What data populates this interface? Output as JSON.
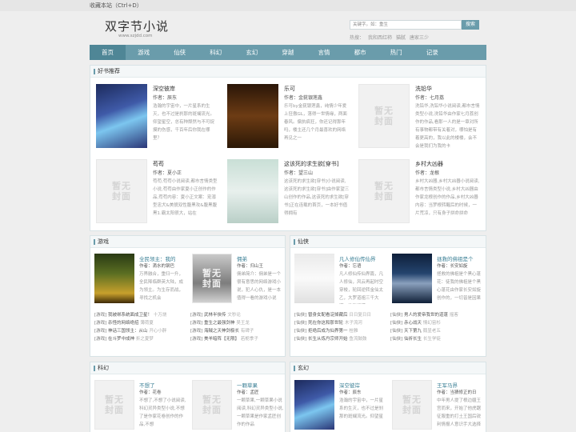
{
  "topbar": {
    "favorite": "收藏本站（Ctrl+D）"
  },
  "header": {
    "logo": "双字节小说",
    "domain": "www.szjdd.com",
    "search_placeholder": "关键字。如：重生",
    "search_button": "搜索",
    "hot_label": "热搜：",
    "hot_items": [
      "我和西红柿",
      "猫腻",
      "唐家三少"
    ]
  },
  "nav": [
    "首页",
    "游戏",
    "仙侠",
    "科幻",
    "玄幻",
    "穿越",
    "言情",
    "都市",
    "热门",
    "记录"
  ],
  "recommend": {
    "title": "好书推荐",
    "items": [
      {
        "name": "深空彼岸",
        "author": "作者：辰东",
        "desc": "浩瀚的宇宙中，一片星系的生灭，也不过是刹那的斑斓流光。仰望星空，总有种颓然与不可捉摸的伤感，千百年后你我在哪里？",
        "cover": "art1"
      },
      {
        "name": "乐可",
        "author": "作者：金莸银莲鑫",
        "desc": "乐可by金莸银莲鑫，纯情少年爱上狂傲GL，落得一世情缘，两面春风。偏执疯狂，你还记得那年吗，楼主还几个月最喜欢的网络再见之一",
        "cover": "art2"
      },
      {
        "name": "洗铅华",
        "author": "作者：七月荔",
        "desc": "洗铅华,洗铅华小说阅读,都市言情类型小说,洗铅华由作家七月荔创作的作品,看那一人的是一章对所有事物都带有关着对，哪怕是有着更高的，我以此的楼楼，会不会是我们为我的卡",
        "cover": "none"
      },
      {
        "name": "苟苟",
        "author": "作者：夏小正",
        "desc": "苟苟,苟苟小说阅读,都市言情类型小说,苟苟由作家夏小正创作的作品,苟苟内容：夏小正文案：宠溺型忠犬&美貌双性腹黑攻&腹黑腹黑1.霸太阳很大，站在",
        "cover": "none"
      },
      {
        "name": "这该死的求生欲[穿书]",
        "author": "作者：望三山",
        "desc": "这该死的求生欲[穿书]小说阅读,这该死的求生欲[穿书]由作家望三山创作的作品,这该死的求生欲[穿书]正在连载的首页，一本好书值得拥有",
        "cover": "art3"
      },
      {
        "name": "乡村大凶器",
        "author": "作者：龙根",
        "desc": "乡村大凶器,乡村大凶器小说阅读,都市言情类型小说,乡村大凶器由作家龙根创作的作品,乡村大凶器内容：当罗根转醒后的时候，一片荒凉，只有身子拼命拼命",
        "cover": "none"
      }
    ]
  },
  "sections": [
    {
      "title": "游戏",
      "items": [
        {
          "name": "全民领主：我的",
          "author": "作者：滴水的钢巴",
          "desc": "万界融合，重归一升，全民降临群英大陆，成为领主。为生存而战，寻找之机会",
          "cover": "art4"
        },
        {
          "name": "佣弟",
          "author": "作者：归山王",
          "desc": "佣弟简介：佣弟是一个很有意思的网络游戏小说，犯人心仇，是一本值得一看的游戏小说",
          "cover": "none"
        }
      ],
      "list": [
        {
          "cat": "[游戏]",
          "title": "我被绑系统面成卫星！",
          "author": "十万烧"
        },
        {
          "cat": "[游戏]",
          "title": "武林半侠传",
          "author": "文秒论"
        },
        {
          "cat": "[游戏]",
          "title": "杀怪的网络绝招",
          "author": "薄荷夏"
        },
        {
          "cat": "[游戏]",
          "title": "重生之最强剑神",
          "author": "吴王龙"
        },
        {
          "cat": "[游戏]",
          "title": "神话三国领主：从山",
          "author": "开心小胖"
        },
        {
          "cat": "[游戏]",
          "title": "海贼之天神剑极长",
          "author": "有碑子"
        },
        {
          "cat": "[游戏]",
          "title": "在斗罗中成神",
          "author": "折之夏梦"
        },
        {
          "cat": "[游戏]",
          "title": "美羊暗阵【无限】",
          "author": "若栀季子"
        }
      ]
    },
    {
      "title": "仙侠",
      "items": [
        {
          "name": "凡人修仙传仙界",
          "author": "作者：忘语",
          "desc": "凡人修仙传仙界篇，凡人修仙，风云再起时空穿梭，轮回逆转金仙太乙，大罗道祖三千大道，谁能证道",
          "cover": "art1"
        },
        {
          "name": "拯救的佛祖是个",
          "author": "作者：长安如旋",
          "desc": "拯救的佛祖是个黑心蓬花：徒我的佛祖是个黑心蓬花由作家长安如旋创作的，一切皆是因果",
          "cover": "art6"
        }
      ],
      "list": [
        {
          "cat": "[仙侠]",
          "title": "替身女配看淀掉藏后",
          "author": "日日复日日"
        },
        {
          "cat": "[仙侠]",
          "title": "男人的爱帝我世的道蓬",
          "author": "摇客"
        },
        {
          "cat": "[仙侠]",
          "title": "死在你这和那世轮",
          "author": "木子流河"
        },
        {
          "cat": "[仙侠]",
          "title": "赤心战天",
          "author": "情幻宙杉"
        },
        {
          "cat": "[仙侠]",
          "title": "拒绝后成为仙界第一",
          "author": "桂雅"
        },
        {
          "cat": "[仙侠]",
          "title": "天下第九",
          "author": "鹅显老五"
        },
        {
          "cat": "[仙侠]",
          "title": "长生从炼丹宗师开始",
          "author": "鱼流鼓鼓"
        },
        {
          "cat": "[仙侠]",
          "title": "仙祈长生",
          "author": "长生学徒"
        }
      ]
    },
    {
      "title": "科幻",
      "items": [
        {
          "name": "不想了",
          "author": "作者：花卷",
          "desc": "不想了,不想了小说阅读,科幻灵异类型小说,不想了是作家花卷创作的作品,不想",
          "cover": "none"
        },
        {
          "name": "一颗草果",
          "author": "作者：孟匠",
          "desc": "一颗草果,一颗草果小说阅读,科幻灵异类型小说,一颗草果是作家孟匠创作的作品",
          "cover": "none"
        }
      ]
    },
    {
      "title": "玄幻",
      "items": [
        {
          "name": "深空彼岸",
          "author": "作者：辰东",
          "desc": "浩瀚的宇宙中，一片星系的生灭，也不过是刹那的斑斓流光。仰望星",
          "cover": "art1"
        },
        {
          "name": "王军马界",
          "author": "作者：当猜修正的日",
          "desc": "中年男人提了根边疆王宫而来，开始了他虎踞征服重的打土王国后锐利情报人意识手大选择",
          "cover": "none"
        }
      ]
    }
  ],
  "cover_placeholder": "暂无封面",
  "colors": {
    "accent": "#6a9cab",
    "link": "#3a7f95",
    "background": "#eeeeee"
  }
}
